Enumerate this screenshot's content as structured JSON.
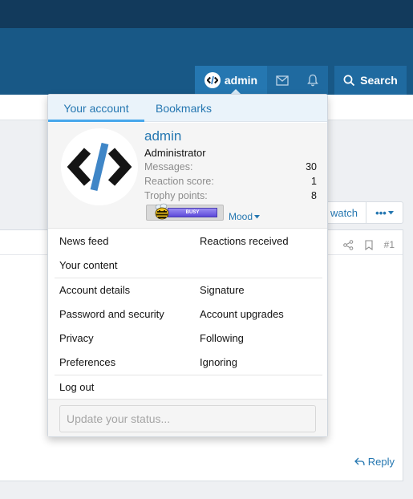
{
  "header": {
    "username": "admin",
    "search_label": "Search"
  },
  "thread_actions": {
    "watch_label": "watch",
    "more_label": "•••"
  },
  "post": {
    "number": "#1",
    "reply_label": "Reply"
  },
  "popup": {
    "tabs": [
      "Your account",
      "Bookmarks"
    ],
    "profile": {
      "username": "admin",
      "user_title": "Administrator",
      "stats": [
        {
          "label": "Messages:",
          "value": "30"
        },
        {
          "label": "Reaction score:",
          "value": "1"
        },
        {
          "label": "Trophy points:",
          "value": "8"
        }
      ],
      "mood_badge_text": "BUSY",
      "mood_label": "Mood"
    },
    "menu": {
      "news_feed": "News feed",
      "reactions_received": "Reactions received",
      "your_content": "Your content",
      "account_details": "Account details",
      "signature": "Signature",
      "password_security": "Password and security",
      "account_upgrades": "Account upgrades",
      "privacy": "Privacy",
      "following": "Following",
      "preferences": "Preferences",
      "ignoring": "Ignoring",
      "log_out": "Log out"
    },
    "status_placeholder": "Update your status..."
  },
  "colors": {
    "topbar": "#123a5c",
    "navbar": "#185886",
    "accent": "#2577b1",
    "tab_underline": "#47a7eb"
  }
}
